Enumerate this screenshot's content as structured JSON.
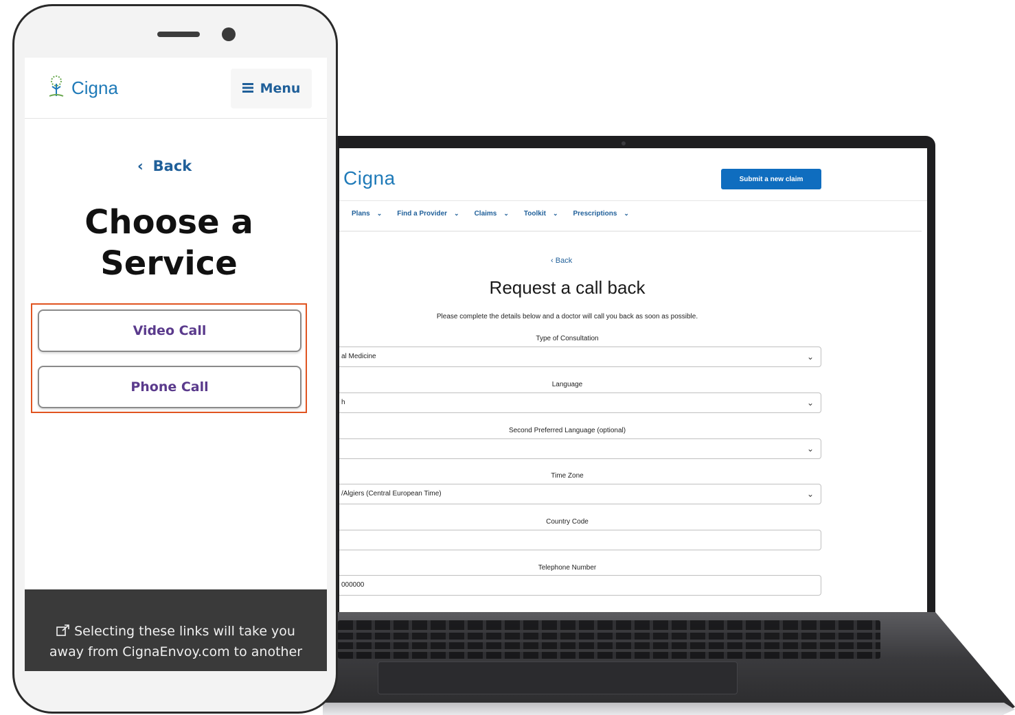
{
  "mobile": {
    "logo_text": "Cigna",
    "menu_label": "Menu",
    "back_label": "Back",
    "title_line1": "Choose a",
    "title_line2": "Service",
    "buttons": [
      {
        "label": "Video Call"
      },
      {
        "label": "Phone Call"
      }
    ],
    "footer_line1": "Selecting these links will take you",
    "footer_line2": "away from CignaEnvoy.com to another"
  },
  "desktop": {
    "logo_text": "Cigna",
    "submit_label": "Submit a new claim",
    "nav": [
      {
        "label": "Plans"
      },
      {
        "label": "Find a Provider"
      },
      {
        "label": "Claims"
      },
      {
        "label": "Toolkit"
      },
      {
        "label": "Prescriptions"
      }
    ],
    "back_label": "Back",
    "title": "Request a call back",
    "description": "Please complete the details below and a doctor will call you back as soon as possible.",
    "fields": [
      {
        "label": "Type of Consultation",
        "value": "al Medicine",
        "type": "select"
      },
      {
        "label": "Language",
        "value": "h",
        "type": "select"
      },
      {
        "label": "Second Preferred Language (optional)",
        "value": "",
        "type": "select"
      },
      {
        "label": "Time Zone",
        "value": "/Algiers (Central European Time)",
        "type": "select"
      },
      {
        "label": "Country Code",
        "value": "",
        "type": "input"
      },
      {
        "label": "Telephone Number",
        "value": "000000",
        "type": "input"
      }
    ]
  },
  "colors": {
    "brand_blue": "#1f7ab8",
    "link_blue": "#1f5f99",
    "button_purple": "#5a3a8c",
    "highlight_orange": "#e0531f",
    "submit_blue": "#0f6dbf"
  },
  "icons": [
    "cigna-tree-icon",
    "hamburger-icon",
    "chevron-left-icon",
    "chevron-down-icon",
    "external-link-icon"
  ]
}
